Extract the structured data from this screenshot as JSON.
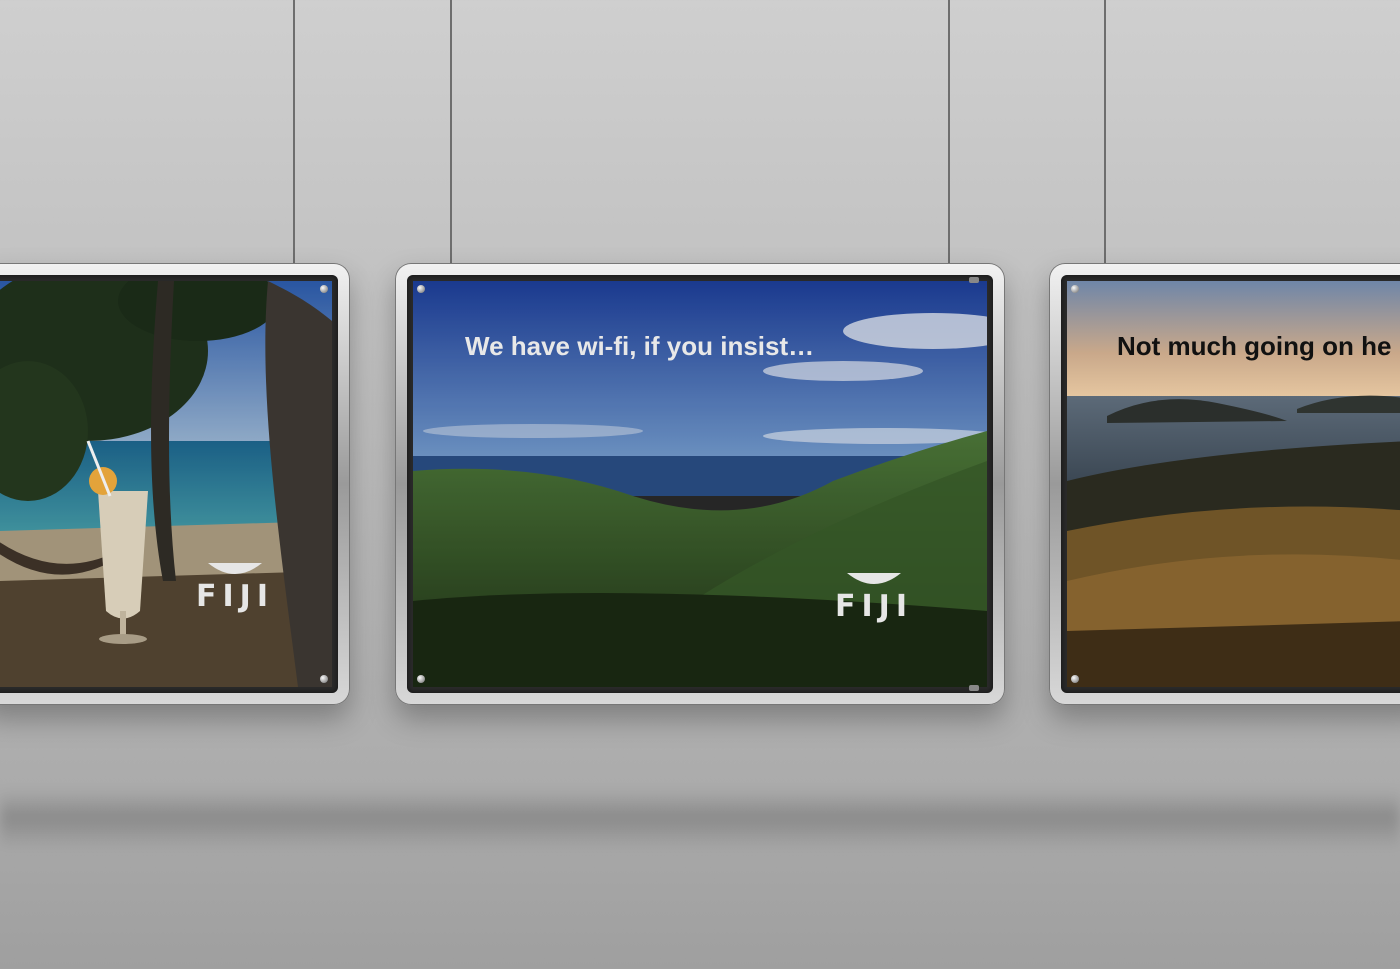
{
  "posters": [
    {
      "headline": "",
      "logo": "FIJI",
      "scene": "beach-with-palms-and-cocktail"
    },
    {
      "headline": "We have wi-fi, if you insist…",
      "logo": "FIJI",
      "scene": "green-hills-over-ocean"
    },
    {
      "headline": "Not much going on he",
      "logo": "",
      "scene": "sunset-grass-and-islands"
    }
  ],
  "colors": {
    "headline_light": "#e8e8e8",
    "headline_dark": "#111111"
  }
}
